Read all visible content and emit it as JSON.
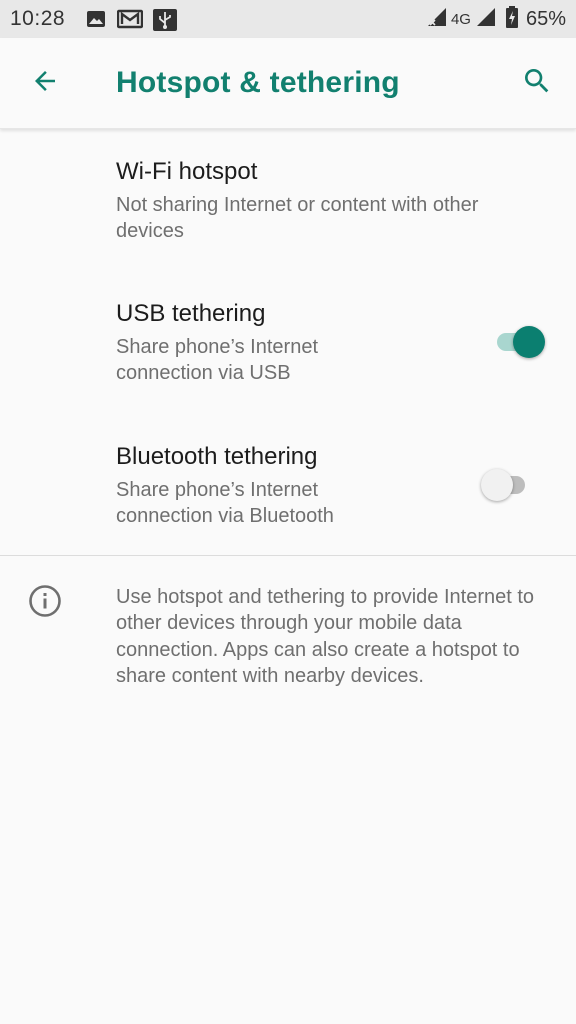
{
  "status_bar": {
    "time": "10:28",
    "network": "4G",
    "battery_percent": "65%",
    "icons": [
      "image-icon",
      "gmail-icon",
      "usb-icon",
      "signal-icon",
      "battery-charging-icon"
    ]
  },
  "app_bar": {
    "title": "Hotspot & tethering",
    "back_icon": "arrow-left-icon",
    "search_icon": "search-icon"
  },
  "preferences": [
    {
      "title": "Wi-Fi hotspot",
      "summary": "Not sharing Internet or content with other devices"
    },
    {
      "title": "USB tethering",
      "summary": "Share phone’s Internet connection via USB",
      "toggle_on": true
    },
    {
      "title": "Bluetooth tethering",
      "summary": "Share phone’s Internet connection via Bluetooth",
      "toggle_on": false
    }
  ],
  "footer_info": {
    "icon": "info-icon",
    "text": "Use hotspot and tethering to provide Internet to other devices through your mobile data connection. Apps can also create a hotspot to share content with nearby devices."
  },
  "colors": {
    "accent": "#12806f",
    "toggle_on_thumb": "#0b7f70",
    "toggle_on_track": "#a9d6cf",
    "background": "#fafafa",
    "status_bar": "#e8e8e8"
  }
}
